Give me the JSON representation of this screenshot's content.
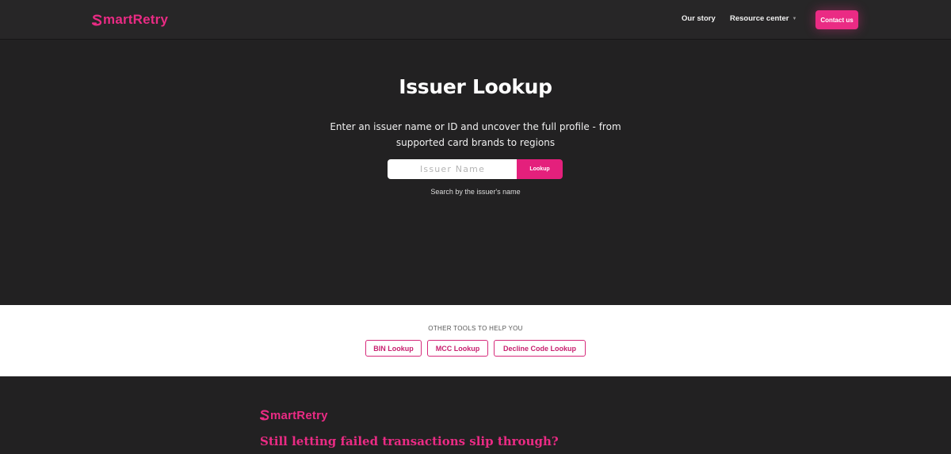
{
  "brand": {
    "name": "martRetry",
    "initial": "S",
    "color": "#ea2b84"
  },
  "nav": {
    "our_story": "Our story",
    "resource_center": "Resource center",
    "contact": "Contact us"
  },
  "hero": {
    "title": "Issuer Lookup",
    "subtitle": "Enter an issuer name or ID and uncover the full profile - from supported card brands to regions",
    "search_placeholder": "Issuer Name",
    "search_value": "",
    "lookup_button": "Lookup",
    "hint": "Search by the issuer's name"
  },
  "tools": {
    "heading": "OTHER TOOLS TO HELP YOU",
    "items": [
      "BIN Lookup",
      "MCC Lookup",
      "Decline Code Lookup"
    ]
  },
  "footer": {
    "brand": "martRetry",
    "tagline": "Still letting failed transactions slip through?"
  },
  "colors": {
    "accent": "#ea2b84",
    "background": "#222122",
    "header": "#272627",
    "strip": "#ffffff"
  },
  "icons": {
    "brand_mark": "s-swoosh-icon",
    "dropdown": "chevron-down-icon"
  }
}
